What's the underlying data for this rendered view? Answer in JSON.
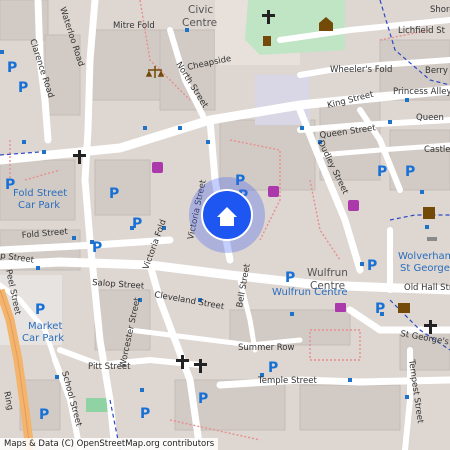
{
  "streets": {
    "waterloo_road": "Waterloo Road",
    "mitre_fold": "Mitre Fold",
    "clarence_road": "Clarence Road",
    "cheapside": "Cheapside",
    "north_street": "North Street",
    "wheelers_fold": "Wheeler's Fold",
    "berry": "Berry",
    "lichfield_st": "Lichfield St",
    "shore": "Shore",
    "princess_alley": "Princess Alley",
    "queen_street_right": "Queen",
    "king_street": "King Street",
    "queen_street": "Queen Street",
    "castle": "Castle",
    "dudley_street": "Dudley Street",
    "victoria_street": "Victoria Street",
    "fold_street": "Fold Street",
    "victoria_fold": "Victoria Fold",
    "p_street": "p Street",
    "peel_street": "Peel Street",
    "salop_street": "Salop Street",
    "cleveland_street": "Cleveland Street",
    "bell_street": "Bell Street",
    "summer_row": "Summer Row",
    "worcester_street": "Worcester Street",
    "pitt_street": "Pitt Street",
    "temple_street": "Temple Street",
    "school_street": "School Street",
    "st_georges": "St George's",
    "tempest_street": "Tempest Street",
    "ring": "Ring",
    "wolfrun_centre": "Wulfrun Centre"
  },
  "places": {
    "civic_centre_1": "Civic",
    "civic_centre_2": "Centre",
    "fold_street_car_park_1": "Fold Street",
    "fold_street_car_park_2": "Car Park",
    "market_car_park_1": "Market",
    "market_car_park_2": "Car Park",
    "wulfrun_centre_1": "Wulfrun",
    "wulfrun_centre_2": "Centre",
    "old_hall_street": "Old Hall Str",
    "wolverhampton_1": "Wolverham",
    "wolverhampton_2": "St George"
  },
  "parking_label": "P",
  "location_marker": "home-marker",
  "attribution": "Maps & Data (C) OpenStreetMap.org contributors"
}
